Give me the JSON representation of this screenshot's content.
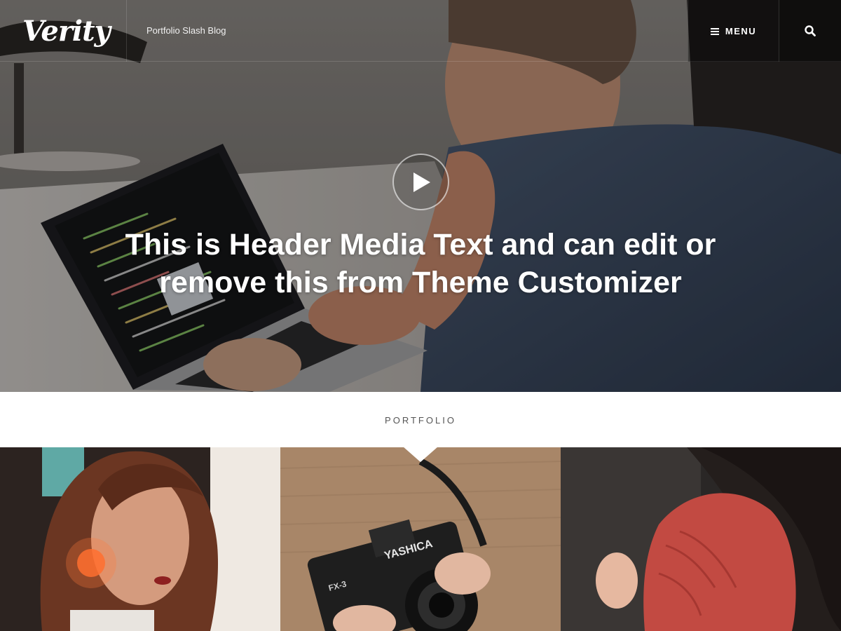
{
  "header": {
    "logo": "Verity",
    "tagline": "Portfolio Slash Blog",
    "menu_label": "MENU",
    "menu_icon": "hamburger-icon",
    "search_icon": "search-icon"
  },
  "hero": {
    "play_icon": "play-icon",
    "text": "This is Header Media Text and can edit or remove this from Theme Customizer"
  },
  "portfolio": {
    "title": "PORTFOLIO",
    "items": [
      {
        "image": "woman-portrait-photo"
      },
      {
        "image": "yashica-camera-photo",
        "camera_brand": "YASHICA",
        "camera_model": "FX-3"
      },
      {
        "image": "woman-red-jacket-photo"
      }
    ]
  },
  "colors": {
    "accent": "#ffffff",
    "section_title": "#555555",
    "background": "#ffffff"
  }
}
